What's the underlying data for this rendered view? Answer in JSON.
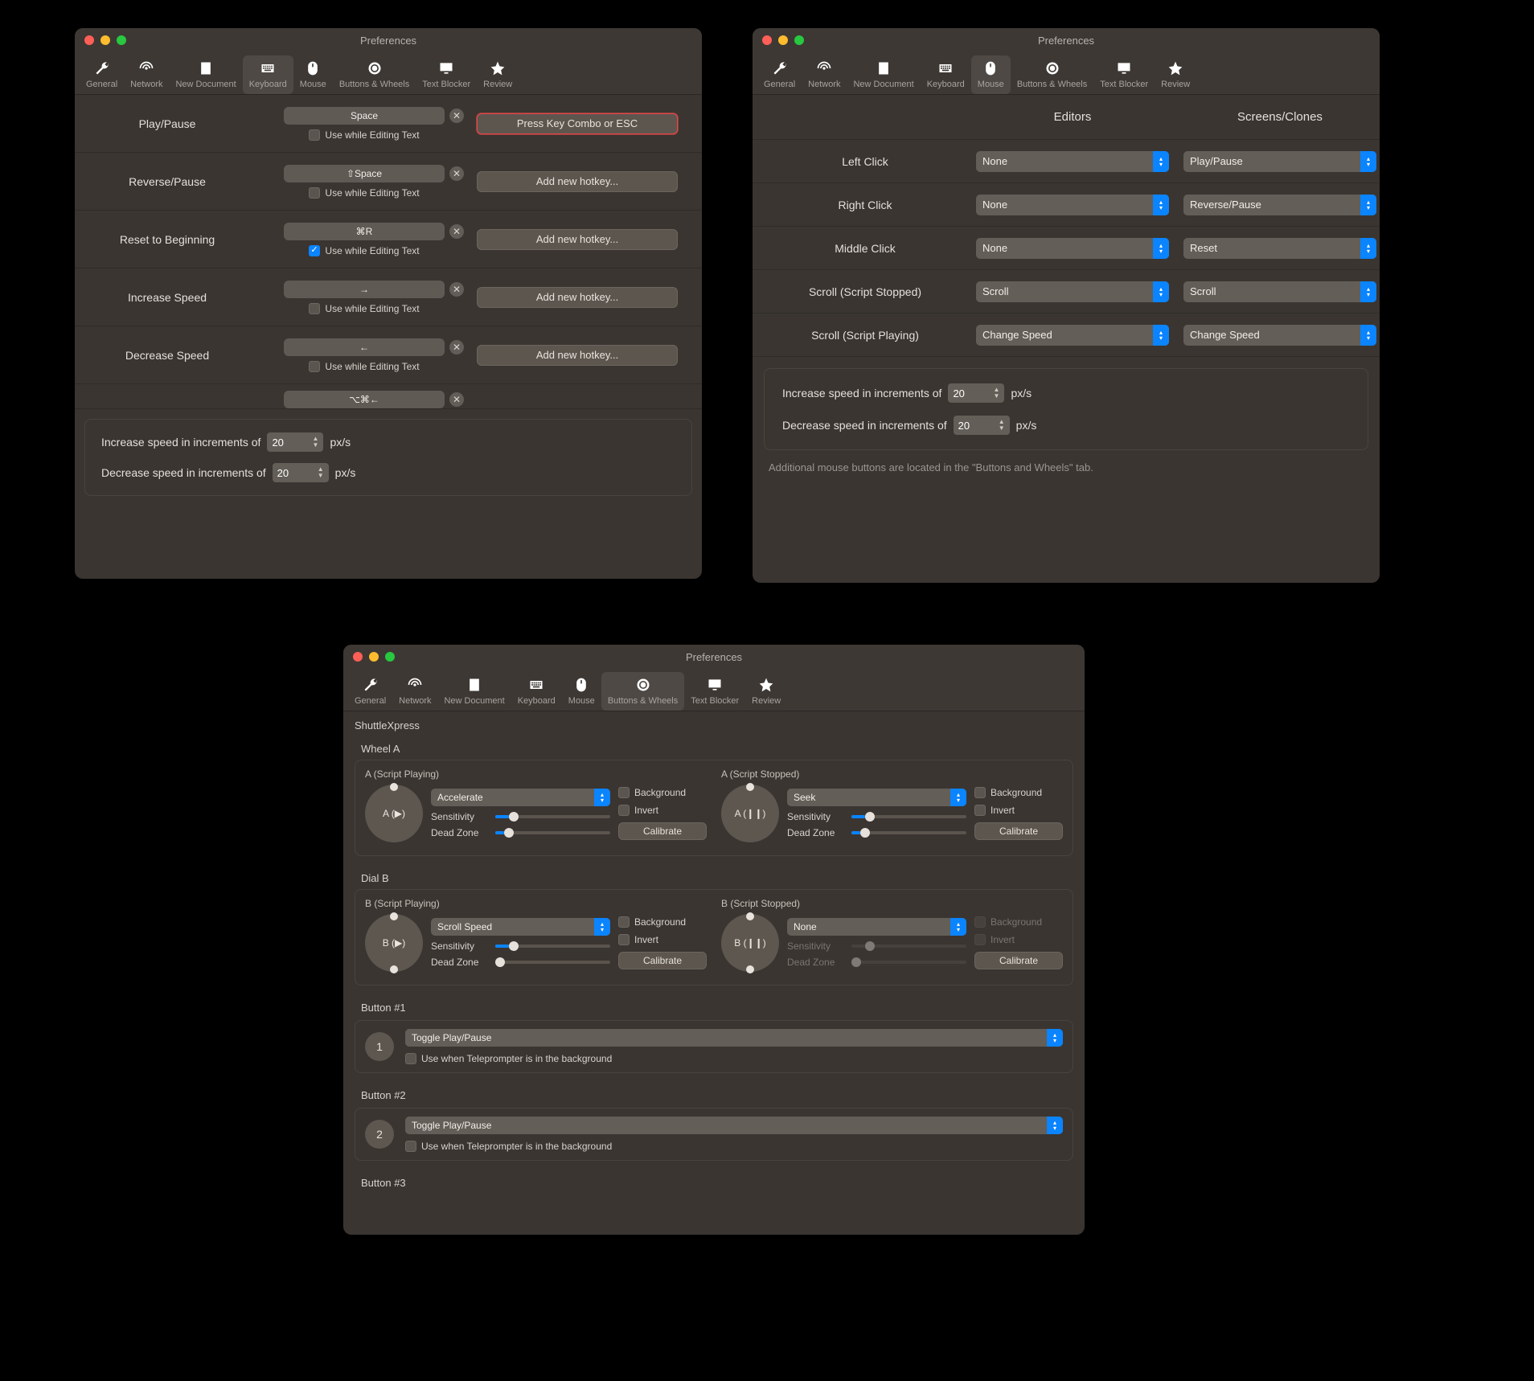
{
  "title": "Preferences",
  "toolbar": {
    "general": "General",
    "network": "Network",
    "newdoc": "New Document",
    "keyboard": "Keyboard",
    "mouse": "Mouse",
    "buttons_wheels": "Buttons & Wheels",
    "text_blocker": "Text Blocker",
    "review": "Review"
  },
  "kb": {
    "rows": [
      {
        "label": "Play/Pause",
        "key": "Space",
        "checked": false,
        "extra_btn": "Press Key Combo or ESC",
        "red": true
      },
      {
        "label": "Reverse/Pause",
        "key": "⇧Space",
        "checked": false,
        "extra_btn": "Add new hotkey...",
        "red": false
      },
      {
        "label": "Reset to Beginning",
        "key": "⌘R",
        "checked": true,
        "extra_btn": "Add new hotkey...",
        "red": false
      },
      {
        "label": "Increase Speed",
        "key": "→",
        "checked": false,
        "extra_btn": "Add new hotkey...",
        "red": false
      },
      {
        "label": "Decrease Speed",
        "key": "←",
        "checked": false,
        "extra_btn": "Add new hotkey...",
        "red": false
      }
    ],
    "partial_key": "⌥⌘←",
    "use_while": "Use while Editing Text",
    "inc_label": "Increase speed in increments of",
    "dec_label": "Decrease speed in increments of",
    "inc_val": "20",
    "dec_val": "20",
    "unit": "px/s"
  },
  "ms": {
    "col_editors": "Editors",
    "col_screens": "Screens/Clones",
    "rows": [
      {
        "label": "Left Click",
        "editors": "None",
        "screens": "Play/Pause"
      },
      {
        "label": "Right Click",
        "editors": "None",
        "screens": "Reverse/Pause"
      },
      {
        "label": "Middle Click",
        "editors": "None",
        "screens": "Reset"
      },
      {
        "label": "Scroll (Script Stopped)",
        "editors": "Scroll",
        "screens": "Scroll"
      },
      {
        "label": "Scroll (Script Playing)",
        "editors": "Change Speed",
        "screens": "Change Speed"
      }
    ],
    "inc_label": "Increase speed in increments of",
    "dec_label": "Decrease speed in increments of",
    "inc_val": "20",
    "dec_val": "20",
    "unit": "px/s",
    "note": "Additional mouse buttons are located in the \"Buttons and Wheels\" tab."
  },
  "bw": {
    "device": "ShuttleXpress",
    "wheel_a": "Wheel A",
    "dial_b": "Dial B",
    "a_play": "A (Script Playing)",
    "a_stop": "A (Script Stopped)",
    "b_play": "B (Script Playing)",
    "b_stop": "B (Script Stopped)",
    "a_play_sym": "A (▶)",
    "a_stop_sym": "A (❙❙)",
    "b_play_sym": "B (▶)",
    "b_stop_sym": "B (❙❙)",
    "sel_accelerate": "Accelerate",
    "sel_seek": "Seek",
    "sel_scrollspeed": "Scroll Speed",
    "sel_none": "None",
    "background": "Background",
    "invert": "Invert",
    "sensitivity": "Sensitivity",
    "deadzone": "Dead Zone",
    "calibrate": "Calibrate",
    "button1": "Button #1",
    "button2": "Button #2",
    "button3": "Button #3",
    "btn_action": "Toggle Play/Pause",
    "btn_bg": "Use when Teleprompter is in the background",
    "n1": "1",
    "n2": "2"
  }
}
